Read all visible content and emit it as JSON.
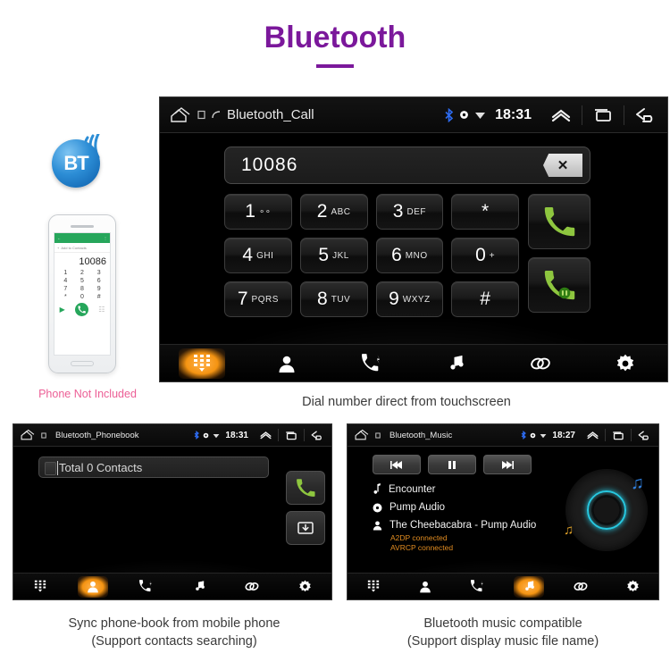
{
  "header": {
    "title": "Bluetooth"
  },
  "bt_logo": {
    "label": "BT",
    "icon": "bluetooth-signal-icon"
  },
  "phone_mockup": {
    "app_bar_back": "back-arrow-icon",
    "app_bar_right": "more-icon",
    "add_contact_label": "Add to Contacts",
    "number": "10086",
    "keys": [
      "1",
      "2",
      "3",
      "4",
      "5",
      "6",
      "7",
      "8",
      "9",
      "*",
      "0",
      "#"
    ],
    "call_icon": "call-icon",
    "note": "Phone Not Included",
    "note_color": "#ec5f96"
  },
  "screens": {
    "call": {
      "statusbar": {
        "home_icon": "home-icon",
        "sd_icon": "sd-card-icon",
        "call_icon": "phone-handset-icon",
        "title": "Bluetooth_Call",
        "bluetooth_icon": "bluetooth-icon",
        "signal_icon": "signal-dot-icon",
        "wifi_icon": "wifi-icon",
        "clock": "18:31",
        "chevron_icon": "chevron-up-icon",
        "recents_icon": "recents-icon",
        "back_icon": "back-icon"
      },
      "dial": {
        "number": "10086",
        "backspace_icon": "backspace-icon"
      },
      "keypad": [
        [
          {
            "num": "1",
            "sub": "∞",
            "name": "key-1"
          },
          {
            "num": "2",
            "sub": "ABC",
            "name": "key-2"
          },
          {
            "num": "3",
            "sub": "DEF",
            "name": "key-3"
          },
          {
            "num": "*",
            "sub": "",
            "name": "key-star"
          }
        ],
        [
          {
            "num": "4",
            "sub": "GHI",
            "name": "key-4"
          },
          {
            "num": "5",
            "sub": "JKL",
            "name": "key-5"
          },
          {
            "num": "6",
            "sub": "MNO",
            "name": "key-6"
          },
          {
            "num": "0",
            "sub": "+",
            "name": "key-0"
          }
        ],
        [
          {
            "num": "7",
            "sub": "PQRS",
            "name": "key-7"
          },
          {
            "num": "8",
            "sub": "TUV",
            "name": "key-8"
          },
          {
            "num": "9",
            "sub": "WXYZ",
            "name": "key-9"
          },
          {
            "num": "#",
            "sub": "",
            "name": "key-hash"
          }
        ]
      ],
      "call_buttons": [
        {
          "name": "dial-call-button",
          "icon": "call-icon"
        },
        {
          "name": "end-call-button",
          "icon": "call-transfer-icon"
        }
      ],
      "navbar": [
        {
          "name": "nav-keypad",
          "icon": "keypad-icon",
          "active": true
        },
        {
          "name": "nav-contacts",
          "icon": "contacts-icon",
          "active": false
        },
        {
          "name": "nav-call-history",
          "icon": "call-history-icon",
          "active": false
        },
        {
          "name": "nav-music",
          "icon": "music-note-icon",
          "active": false
        },
        {
          "name": "nav-pair",
          "icon": "link-icon",
          "active": false
        },
        {
          "name": "nav-settings",
          "icon": "gear-icon",
          "active": false
        }
      ],
      "caption": "Dial number direct from touchscreen"
    },
    "phonebook": {
      "statusbar": {
        "title": "Bluetooth_Phonebook",
        "clock": "18:31"
      },
      "search_value": "Total 0 Contacts",
      "buttons": [
        {
          "name": "phonebook-call-button",
          "icon": "call-icon"
        },
        {
          "name": "phonebook-download-button",
          "icon": "download-contacts-icon"
        }
      ],
      "navbar": [
        {
          "name": "nav-keypad",
          "icon": "keypad-icon",
          "active": false
        },
        {
          "name": "nav-contacts",
          "icon": "contacts-icon",
          "active": true
        },
        {
          "name": "nav-call-history",
          "icon": "call-history-icon",
          "active": false
        },
        {
          "name": "nav-music",
          "icon": "music-note-icon",
          "active": false
        },
        {
          "name": "nav-pair",
          "icon": "link-icon",
          "active": false
        },
        {
          "name": "nav-settings",
          "icon": "gear-icon",
          "active": false
        }
      ],
      "caption_line1": "Sync phone-book from mobile phone",
      "caption_line2": "(Support contacts searching)"
    },
    "music": {
      "statusbar": {
        "title": "Bluetooth_Music",
        "clock": "18:27"
      },
      "transport": [
        {
          "name": "previous-track-button",
          "icon": "previous-icon"
        },
        {
          "name": "pause-button",
          "icon": "pause-icon"
        },
        {
          "name": "next-track-button",
          "icon": "next-icon"
        }
      ],
      "track": {
        "title": "Encounter",
        "album": "Pump Audio",
        "artist": "The Cheebacabra - Pump Audio",
        "status1": "A2DP connected",
        "status2": "AVRCP connected",
        "status_color": "#e08b20"
      },
      "navbar": [
        {
          "name": "nav-keypad",
          "icon": "keypad-icon",
          "active": false
        },
        {
          "name": "nav-contacts",
          "icon": "contacts-icon",
          "active": false
        },
        {
          "name": "nav-call-history",
          "icon": "call-history-icon",
          "active": false
        },
        {
          "name": "nav-music",
          "icon": "music-note-icon",
          "active": true
        },
        {
          "name": "nav-pair",
          "icon": "link-icon",
          "active": false
        },
        {
          "name": "nav-settings",
          "icon": "gear-icon",
          "active": false
        }
      ],
      "caption_line1": "Bluetooth music compatible",
      "caption_line2": "(Support display music file name)"
    }
  },
  "colors": {
    "title": "#7b189b",
    "accent_orange": "#f59412",
    "call_green": "#8ec63f",
    "vinyl_ring": "#27c8e0"
  }
}
